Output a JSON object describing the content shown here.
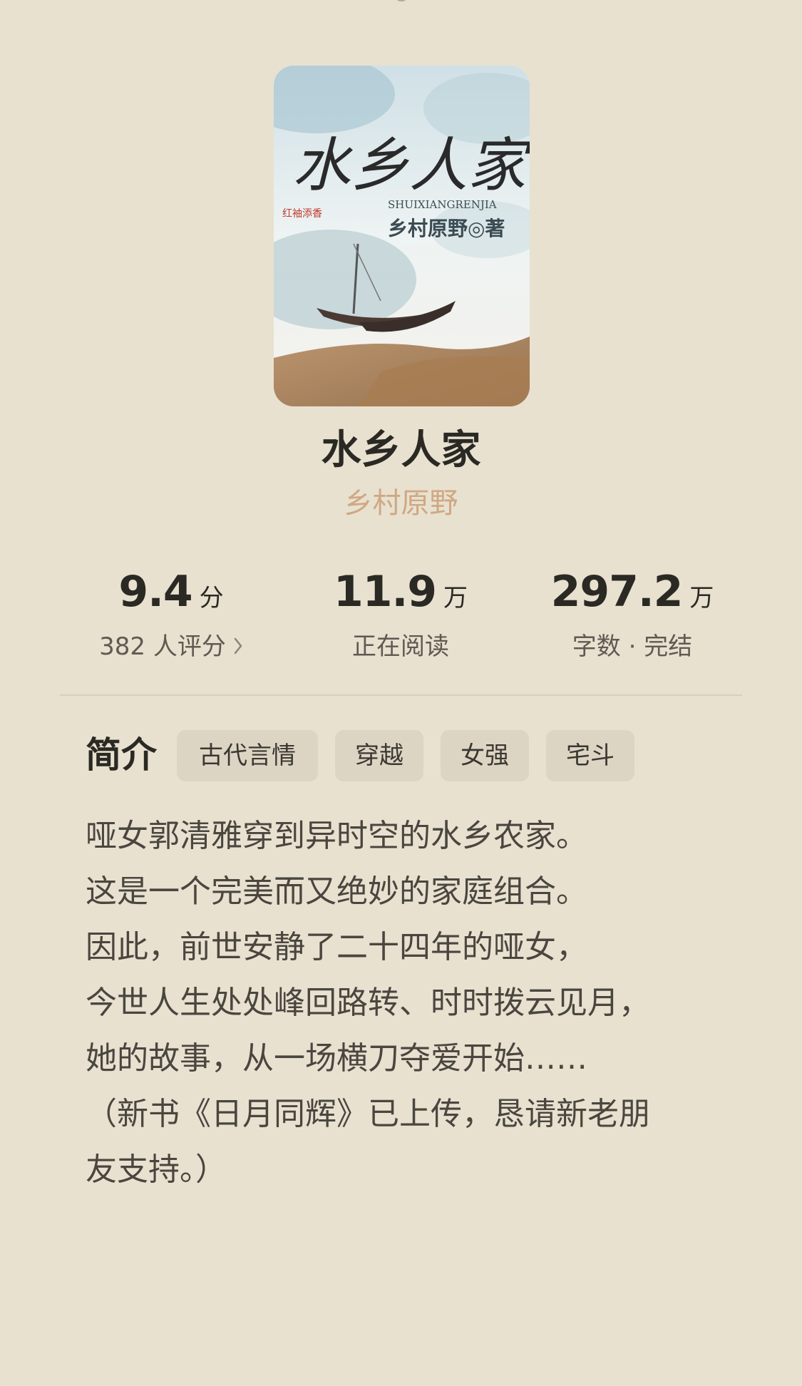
{
  "book": {
    "title": "水乡人家",
    "author": "乡村原野",
    "cover": {
      "calligraphy": "水乡人家",
      "pinyin": "SHUIXIANGRENJIA",
      "author_line": "乡村原野◎著",
      "publisher_mark": "红袖添香"
    }
  },
  "stats": [
    {
      "value": "9.4",
      "unit": "分",
      "label": "382 人评分",
      "has_chevron": true
    },
    {
      "value": "11.9",
      "unit": "万",
      "label": "正在阅读"
    },
    {
      "value": "297.2",
      "unit": "万",
      "label": "字数 · 完结"
    }
  ],
  "intro": {
    "label": "简介",
    "tags": [
      "古代言情",
      "穿越",
      "女强",
      "宅斗"
    ],
    "lines": [
      "哑女郭清雅穿到异时空的水乡农家。",
      "这是一个完美而又绝妙的家庭组合。",
      "因此，前世安静了二十四年的哑女，",
      "今世人生处处峰回路转、时时拨云见月，",
      "她的故事，从一场横刀夺爱开始……",
      "（新书《日月同辉》已上传，恳请新老朋",
      "友支持。）"
    ]
  },
  "colors": {
    "background": "#e8e1d0",
    "author": "#cfa883",
    "tag_bg": "#ddd5c4"
  }
}
